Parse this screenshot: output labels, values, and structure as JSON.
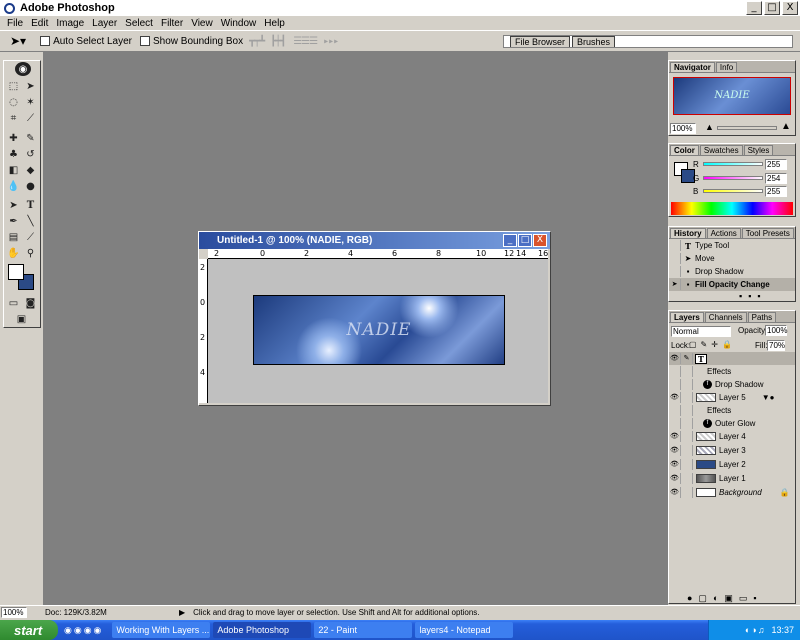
{
  "app": {
    "title": "Adobe Photoshop"
  },
  "window_controls": {
    "minimize": "_",
    "maximize": "□",
    "close": "X"
  },
  "menu": [
    "File",
    "Edit",
    "Image",
    "Layer",
    "Select",
    "Filter",
    "View",
    "Window",
    "Help"
  ],
  "options": {
    "auto_select": "Auto Select Layer",
    "bounding_box": "Show Bounding Box"
  },
  "palette_well": [
    "File Browser",
    "Brushes"
  ],
  "document": {
    "title": "Untitled-1 @ 100% (NADIE, RGB)",
    "banner_text": "NADIE",
    "ruler_top": [
      "2",
      "0",
      "2",
      "4",
      "6",
      "8",
      "10",
      "12",
      "14",
      "16"
    ],
    "ruler_left": [
      "2",
      "0",
      "2",
      "4"
    ]
  },
  "navigator": {
    "tabs": [
      "Navigator",
      "Info"
    ],
    "zoom": "100%",
    "thumb_text": "NADIE"
  },
  "color": {
    "tabs": [
      "Color",
      "Swatches",
      "Styles"
    ],
    "channels": [
      {
        "label": "R",
        "value": "255",
        "color": "#00c8c8"
      },
      {
        "label": "G",
        "value": "254",
        "color": "#c000c0"
      },
      {
        "label": "B",
        "value": "255",
        "color": "#c8c800"
      }
    ],
    "fg": "#ffffff",
    "bg": "#2b4a86"
  },
  "history": {
    "tabs": [
      "History",
      "Actions",
      "Tool Presets"
    ],
    "items": [
      "Type Tool",
      "Move",
      "Drop Shadow",
      "Fill Opacity Change"
    ]
  },
  "layers": {
    "tabs": [
      "Layers",
      "Channels",
      "Paths"
    ],
    "blend_mode": "Normal",
    "opacity_label": "Opacity:",
    "opacity": "100%",
    "lock_label": "Lock:",
    "fill_label": "Fill:",
    "fill": "70%",
    "rows": [
      {
        "name": "",
        "type": "text"
      },
      {
        "name": "Effects",
        "type": "effect-header"
      },
      {
        "name": "Drop Shadow",
        "type": "effect"
      },
      {
        "name": "Layer 5",
        "type": "layer"
      },
      {
        "name": "Effects",
        "type": "effect-header"
      },
      {
        "name": "Outer Glow",
        "type": "effect"
      },
      {
        "name": "Layer 4",
        "type": "layer"
      },
      {
        "name": "Layer 3",
        "type": "layer"
      },
      {
        "name": "Layer 2",
        "type": "layer"
      },
      {
        "name": "Layer 1",
        "type": "layer"
      },
      {
        "name": "Background",
        "type": "background"
      }
    ]
  },
  "status": {
    "zoom": "100%",
    "doc": "Doc: 129K/3.82M",
    "hint": "Click and drag to move layer or selection. Use Shift and Alt for additional options."
  },
  "taskbar": {
    "start": "start",
    "tasks": [
      "Working With Layers ...",
      "Adobe Photoshop",
      "22 - Paint",
      "layers4 - Notepad"
    ],
    "clock": "13:37"
  }
}
